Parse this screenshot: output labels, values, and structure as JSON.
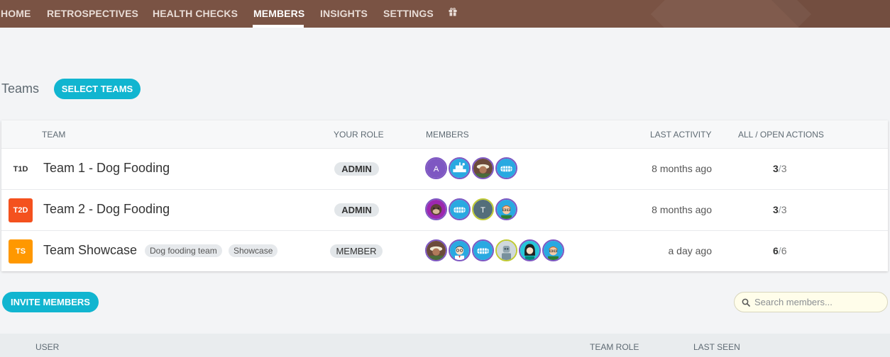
{
  "nav": {
    "items": [
      "HOME",
      "RETROSPECTIVES",
      "HEALTH CHECKS",
      "MEMBERS",
      "INSIGHTS",
      "SETTINGS"
    ],
    "active": "MEMBERS",
    "gift_icon": "gift-icon"
  },
  "teams_section": {
    "title": "Teams",
    "select_button": "SELECT TEAMS"
  },
  "teams_table": {
    "headers": {
      "team": "TEAM",
      "role": "YOUR ROLE",
      "members": "MEMBERS",
      "last_activity": "LAST ACTIVITY",
      "actions": "ALL / OPEN ACTIONS"
    },
    "rows": [
      {
        "badge": "T1D",
        "badge_color": "#ffffff",
        "badge_text_color": "#333333",
        "name": "Team 1 - Dog Fooding",
        "tags": [],
        "role": "ADMIN",
        "members": [
          "letter-A",
          "ship-avatar",
          "photo-avatar",
          "grin-avatar"
        ],
        "last_activity": "8 months ago",
        "all_actions": "3",
        "open_actions": "3"
      },
      {
        "badge": "T2D",
        "badge_color": "#f4511e",
        "badge_text_color": "#ffffff",
        "name": "Team 2 - Dog Fooding",
        "tags": [],
        "role": "ADMIN",
        "members": [
          "monkey-avatar",
          "grin-avatar",
          "letter-T",
          "redhead-avatar"
        ],
        "last_activity": "8 months ago",
        "all_actions": "3",
        "open_actions": "3"
      },
      {
        "badge": "TS",
        "badge_color": "#ff9800",
        "badge_text_color": "#ffffff",
        "name": "Team Showcase",
        "tags": [
          "Dog fooding team",
          "Showcase"
        ],
        "role": "MEMBER",
        "members": [
          "photo-avatar",
          "nerd-avatar",
          "grin-avatar",
          "robot-avatar",
          "girl-avatar",
          "redhead-avatar"
        ],
        "last_activity": "a day ago",
        "all_actions": "6",
        "open_actions": "6"
      }
    ],
    "action_separator": "/"
  },
  "members_section": {
    "invite_button": "INVITE MEMBERS",
    "search_placeholder": "Search members...",
    "search_value": ""
  },
  "users_table": {
    "headers": {
      "user": "USER",
      "team_role": "TEAM ROLE",
      "last_seen": "LAST SEEN"
    }
  },
  "colors": {
    "nav_bg": "#7a5344",
    "accent": "#11b5d0",
    "avatar_ring": "#7e57c2"
  }
}
